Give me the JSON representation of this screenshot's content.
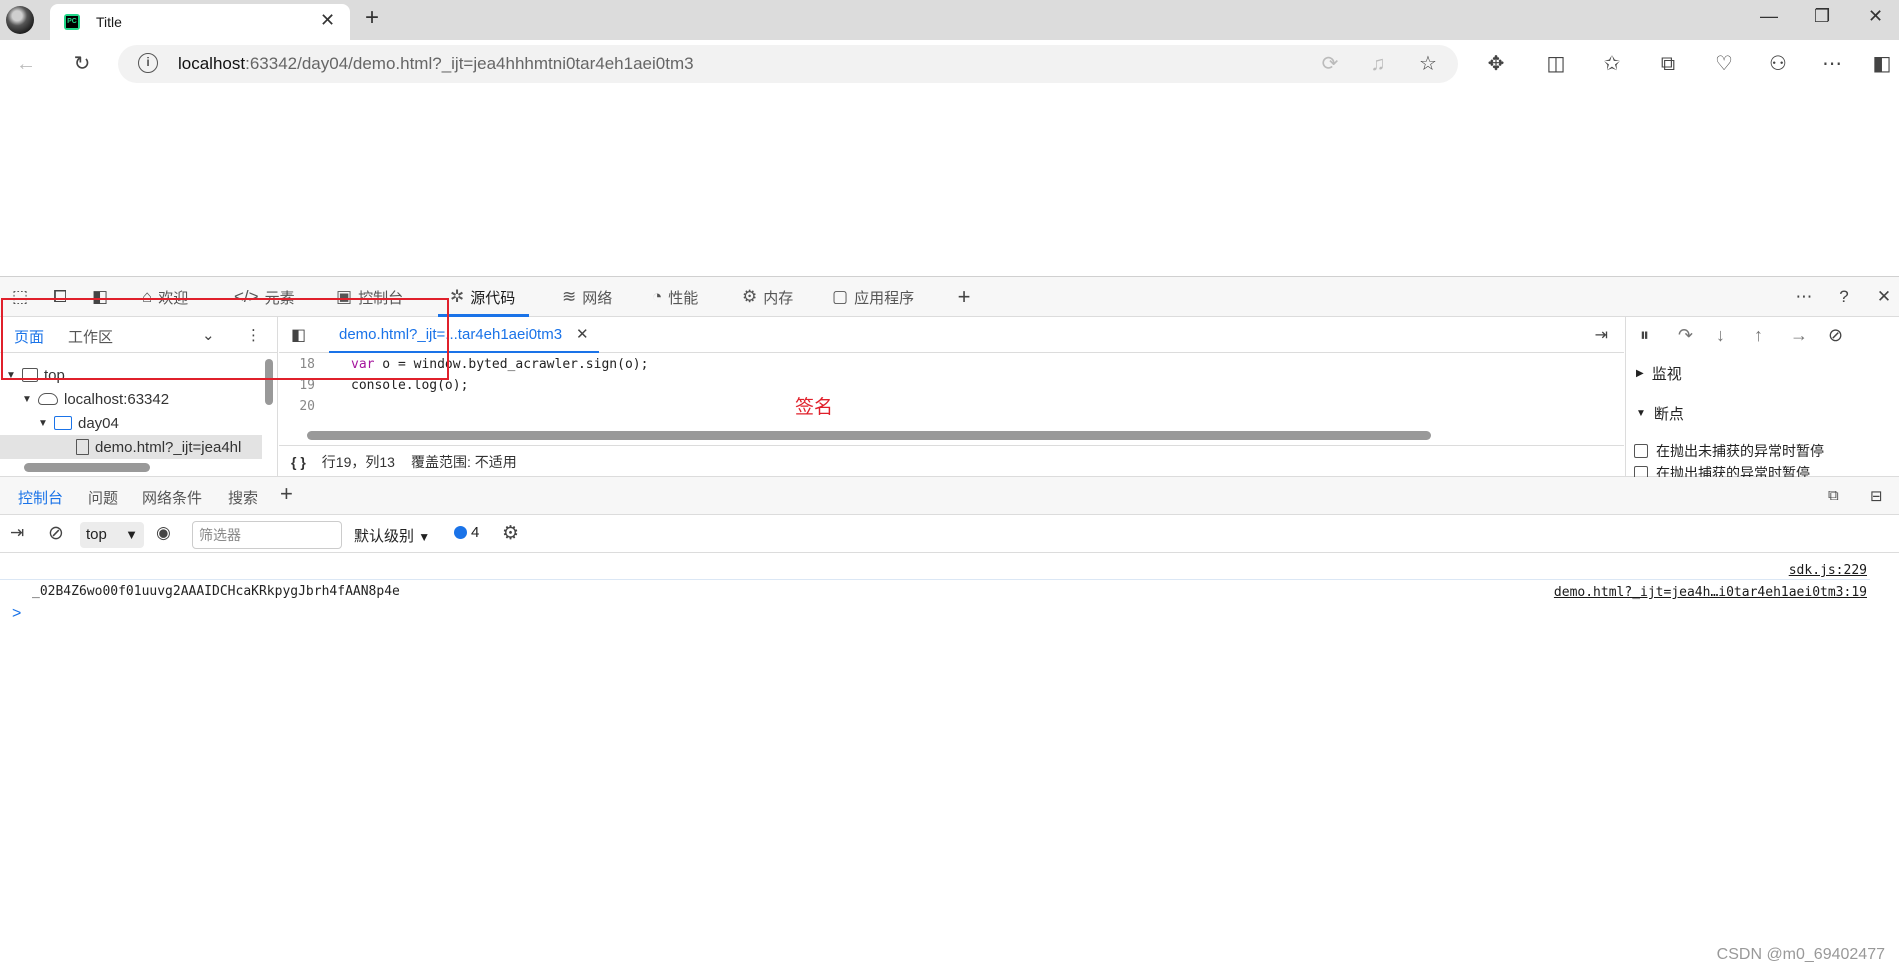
{
  "browser": {
    "tab_title": "Title",
    "favicon_label": "PC",
    "new_tab_icon": "+",
    "url_host": "localhost",
    "url_rest": ":63342/day04/demo.html?_ijt=jea4hhhmtni0tar4eh1aei0tm3"
  },
  "devtools": {
    "tabs": [
      {
        "icon": "⌂",
        "label": "欢迎"
      },
      {
        "icon": "</>",
        "label": "元素"
      },
      {
        "icon": "▣",
        "label": "控制台"
      },
      {
        "icon": "✲",
        "label": "源代码"
      },
      {
        "icon": "≋",
        "label": "网络"
      },
      {
        "icon": "◔",
        "label": "性能"
      },
      {
        "icon": "⚙",
        "label": "内存"
      },
      {
        "icon": "▢",
        "label": "应用程序"
      }
    ],
    "active_tab": "源代码",
    "nav_tabs": [
      "页面",
      "工作区"
    ],
    "tree": {
      "top": "top",
      "host": "localhost:63342",
      "folder": "day04",
      "file": "demo.html?_ijt=jea4hl"
    },
    "file_tab": "demo.html?_ijt=...tar4eh1aei0tm3",
    "code_lines": [
      {
        "num": "18",
        "kw": "var",
        "text": " o = window.byted_acrawler.sign(o);"
      },
      {
        "num": "19",
        "kw": "",
        "text": "console.log(o);"
      },
      {
        "num": "20",
        "kw": "",
        "text": ""
      }
    ],
    "status": {
      "braces": "{ }",
      "position": "行19，列13",
      "coverage": "覆盖范围: 不适用"
    },
    "debugger": {
      "watch": "监视",
      "breakpoints": "断点",
      "uncaught": "在抛出未捕获的异常时暂停",
      "caught": "在抛出捕获的异常时暂停"
    },
    "drawer_tabs": [
      "控制台",
      "问题",
      "网络条件",
      "搜索"
    ],
    "console": {
      "context": "top",
      "filter_placeholder": "筛选器",
      "level": "默认级别",
      "issues_count": "4",
      "sources": [
        "sdk.js:229",
        "demo.html?_ijt=jea4h…i0tar4eh1aei0tm3:19"
      ],
      "log": "_02B4Z6wo00f01uuvg2AAAIDCHcaKRkpygJbrh4fAAN8p4e",
      "prompt": ">"
    }
  },
  "annotation": "签名",
  "watermark": "CSDN @m0_69402477",
  "colors": {
    "accent": "#1a73e8",
    "highlight_red": "#e0202b"
  }
}
